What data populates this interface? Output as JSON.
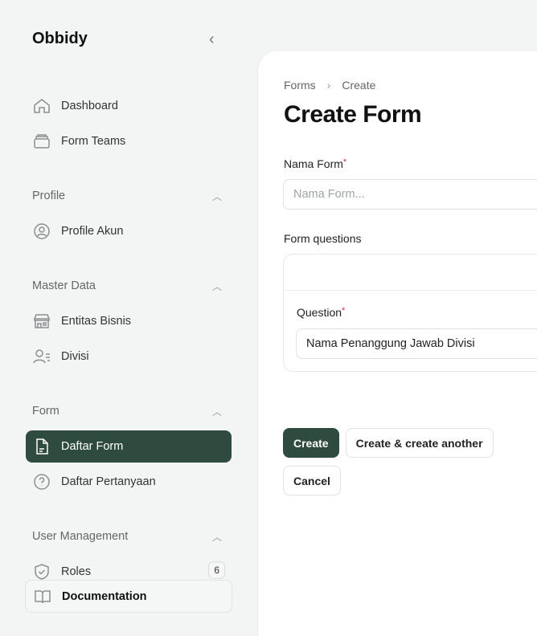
{
  "brand": "Obbidy",
  "sidebar": {
    "items": [
      {
        "label": "Dashboard",
        "icon": "home-icon"
      },
      {
        "label": "Form Teams",
        "icon": "stack-icon"
      },
      {
        "label": "Profile Akun",
        "icon": "user-circle-icon"
      },
      {
        "label": "Entitas Bisnis",
        "icon": "store-icon"
      },
      {
        "label": "Divisi",
        "icon": "users-list-icon"
      },
      {
        "label": "Daftar Form",
        "icon": "document-icon",
        "active": true
      },
      {
        "label": "Daftar Pertanyaan",
        "icon": "question-circle-icon"
      },
      {
        "label": "Roles",
        "icon": "shield-check-icon",
        "badge": "6"
      }
    ],
    "groups": [
      "Profile",
      "Master Data",
      "Form",
      "User Management"
    ],
    "documentation": "Documentation"
  },
  "main": {
    "breadcrumb": [
      "Forms",
      "Create"
    ],
    "title": "Create Form",
    "nama_form_label": "Nama Form",
    "nama_form_placeholder": "Nama Form...",
    "questions_label": "Form questions",
    "question_label": "Question",
    "question_value": "Nama Penanggung Jawab Divisi",
    "buttons": {
      "create": "Create",
      "create_another": "Create & create another",
      "cancel": "Cancel"
    }
  },
  "colors": {
    "accent": "#2f4a3e",
    "required": "#e11d48"
  }
}
